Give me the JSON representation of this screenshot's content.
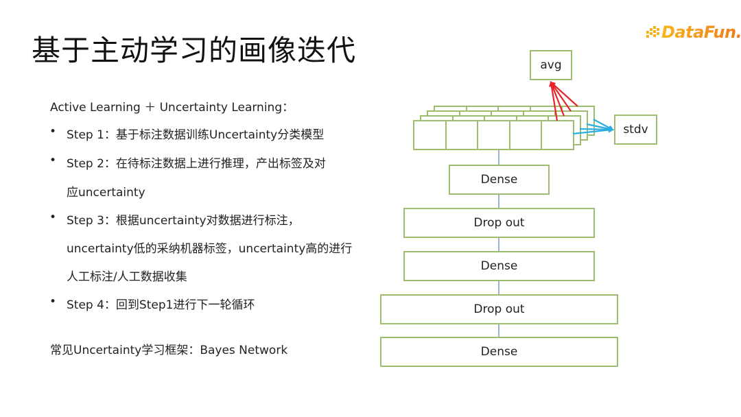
{
  "slide": {
    "title": "基于主动学习的画像迭代",
    "logo": {
      "text": "DataFun.",
      "icon": "datafun-dots-logo-icon"
    }
  },
  "content": {
    "intro": "Active Learning ＋ Uncertainty Learning：",
    "bullet_glyph": "•",
    "steps": [
      {
        "label": "Step 1：基于标注数据训练Uncertainty分类模型"
      },
      {
        "label": "Step 2：在待标注数据上进行推理，产出标签及对",
        "cont": [
          "应uncertainty"
        ]
      },
      {
        "label": "Step 3：根据uncertainty对数据进行标注，",
        "cont": [
          "uncertainty低的采纳机器标签，uncertainty高的进行",
          "人工标注/人工数据收集"
        ]
      },
      {
        "label": "Step 4：回到Step1进行下一轮循环"
      }
    ],
    "framework": "常见Uncertainty学习框架：Bayes Network"
  },
  "diagram": {
    "outputs": {
      "avg": "avg",
      "stdv": "stdv"
    },
    "layers": [
      "Dense",
      "Drop out",
      "Dense",
      "Drop out",
      "Dense"
    ],
    "ensemble": {
      "stack_count": 4,
      "cells_per_layer": 5
    },
    "colors": {
      "box_border": "#9cbc6e",
      "avg_arrow": "#e8232a",
      "stdv_arrow": "#2aaee0",
      "connector": "#5b7fb5"
    }
  }
}
